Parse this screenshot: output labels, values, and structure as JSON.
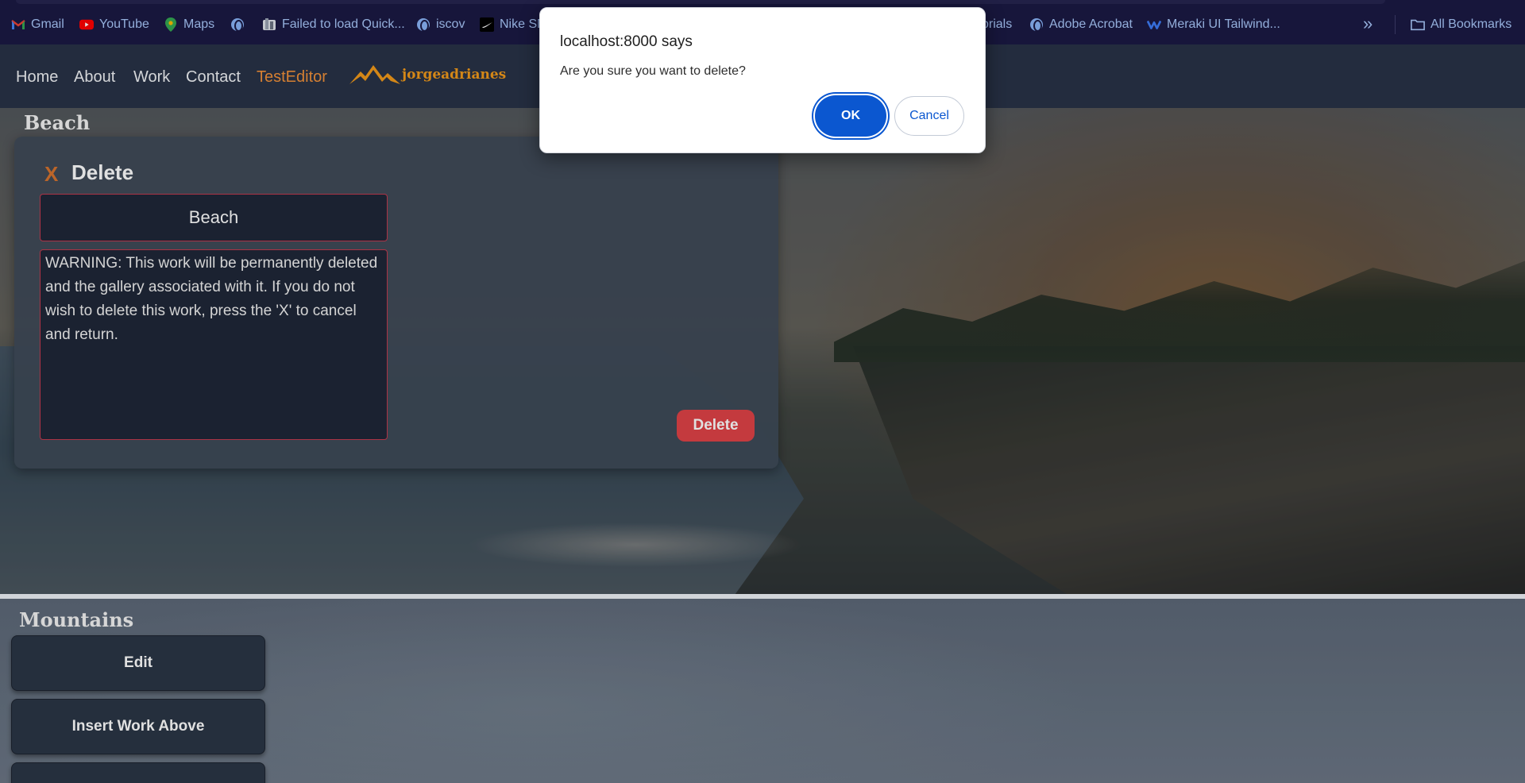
{
  "bookmarks": {
    "items": [
      {
        "label": "Gmail",
        "icon": "gmail-icon"
      },
      {
        "label": "YouTube",
        "icon": "youtube-icon"
      },
      {
        "label": "Maps",
        "icon": "maps-icon"
      },
      {
        "label": "",
        "icon": "globe-icon"
      },
      {
        "label": "Failed to load Quick...",
        "icon": "page-icon"
      },
      {
        "label": "iscov",
        "icon": "globe-icon"
      },
      {
        "label": "Nike SN",
        "icon": "nike-icon"
      },
      {
        "label": "orials",
        "icon": ""
      },
      {
        "label": "Adobe Acrobat",
        "icon": "globe-icon"
      },
      {
        "label": "Meraki UI Tailwind...",
        "icon": "meraki-icon"
      }
    ],
    "more": "»",
    "all_bookmarks": "All Bookmarks"
  },
  "nav": {
    "links": [
      "Home",
      "About",
      "Work",
      "Contact",
      "TestEditor"
    ],
    "logo_text": "jorgeadrianes"
  },
  "beach": {
    "title": "Beach",
    "panel": {
      "close": "X",
      "heading": "Delete",
      "title_value": "Beach",
      "warning": "WARNING: This work will be permanently deleted and the gallery associated with it. If you do not wish to delete this work, press the 'X' to cancel and return.",
      "delete_button": "Delete"
    }
  },
  "mountains": {
    "title": "Mountains",
    "buttons": [
      "Edit",
      "Insert Work Above",
      ""
    ]
  },
  "dialog": {
    "title": "localhost:8000 says",
    "message": "Are you sure you want to delete?",
    "ok": "OK",
    "cancel": "Cancel"
  },
  "colors": {
    "accent": "#f2913a",
    "danger": "#e04347",
    "dialog_primary": "#0b57d0"
  }
}
